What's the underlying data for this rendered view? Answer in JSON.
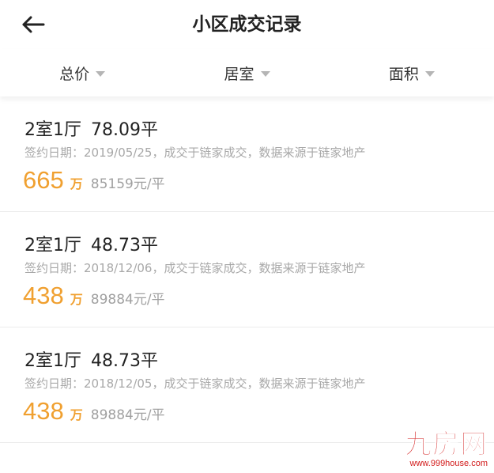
{
  "header": {
    "title": "小区成交记录",
    "back_icon": "arrow-left-icon"
  },
  "filters": [
    {
      "label": "总价",
      "icon": "caret-down-icon"
    },
    {
      "label": "居室",
      "icon": "caret-down-icon"
    },
    {
      "label": "面积",
      "icon": "caret-down-icon"
    }
  ],
  "records": [
    {
      "layout": "2室1厅",
      "area": "78.09平",
      "info": "签约日期：2019/05/25，成交于链家成交，数据来源于链家地产",
      "price": "665",
      "price_unit": "万",
      "unit_price": "85159元/平"
    },
    {
      "layout": "2室1厅",
      "area": "48.73平",
      "info": "签约日期：2018/12/06，成交于链家成交，数据来源于链家地产",
      "price": "438",
      "price_unit": "万",
      "unit_price": "89884元/平"
    },
    {
      "layout": "2室1厅",
      "area": "48.73平",
      "info": "签约日期：2018/12/05，成交于链家成交，数据来源于链家地产",
      "price": "438",
      "price_unit": "万",
      "unit_price": "89884元/平"
    }
  ],
  "watermark": {
    "logo": "九房网",
    "url": "www.999house.com"
  },
  "colors": {
    "price": "#f0a030",
    "secondary_text": "#a8a8a8",
    "watermark": "#d21a1a"
  }
}
